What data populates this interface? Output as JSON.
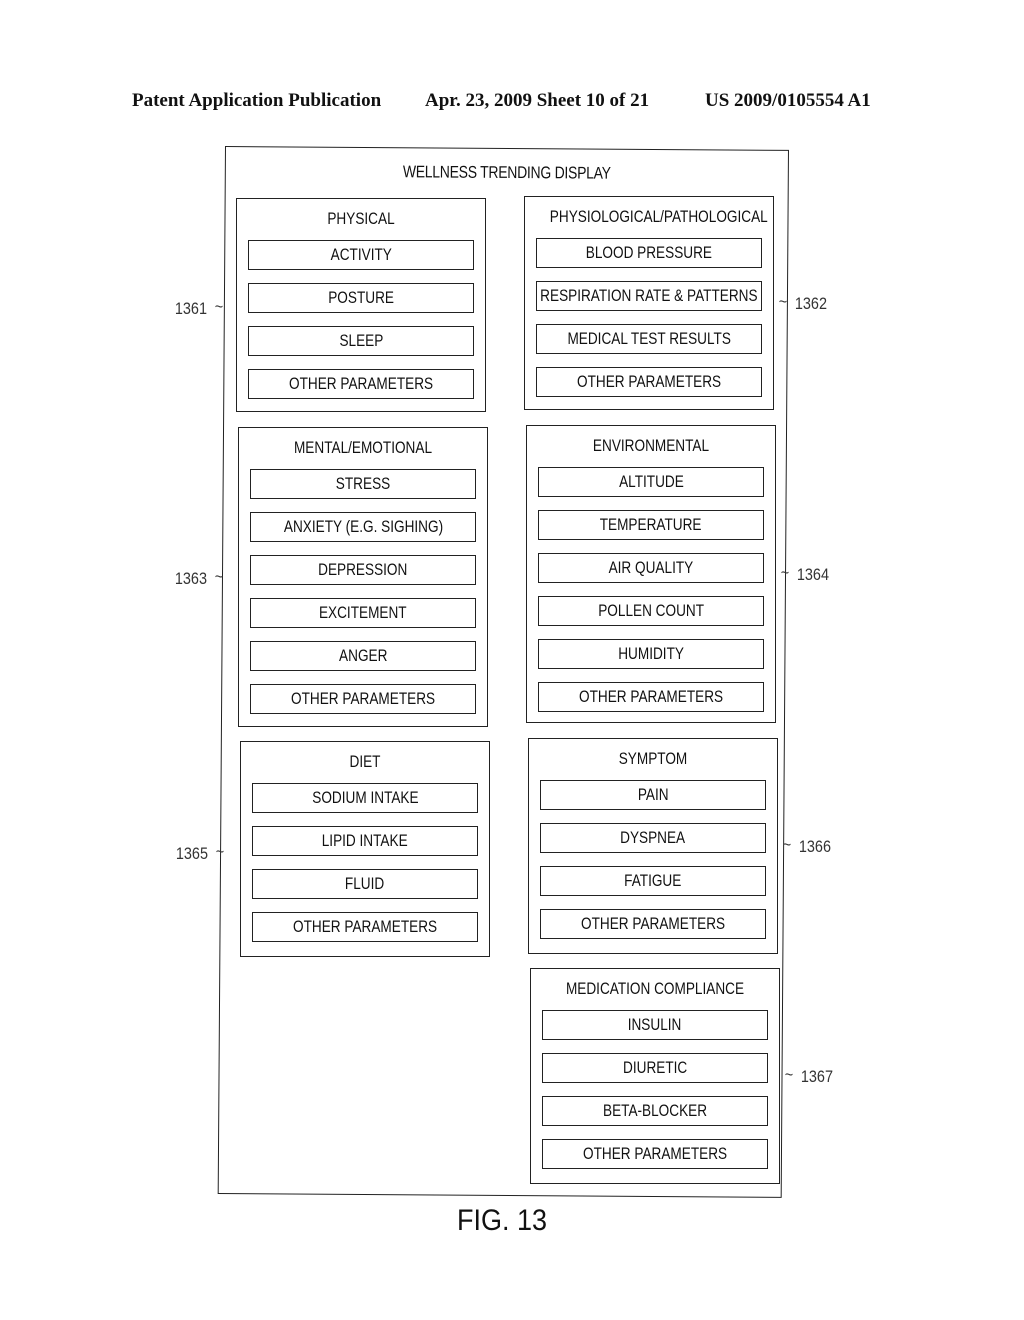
{
  "header": {
    "left": "Patent Application Publication",
    "middle": "Apr. 23, 2009  Sheet 10 of 21",
    "right": "US 2009/0105554 A1"
  },
  "diagram": {
    "title": "WELLNESS TRENDING DISPLAY",
    "groups": [
      {
        "ref": "1361",
        "title": "PHYSICAL",
        "items": [
          "ACTIVITY",
          "POSTURE",
          "SLEEP",
          "OTHER PARAMETERS"
        ]
      },
      {
        "ref": "1362",
        "title": "PHYSIOLOGICAL/PATHOLOGICAL",
        "items": [
          "BLOOD PRESSURE",
          "RESPIRATION RATE & PATTERNS",
          "MEDICAL TEST RESULTS",
          "OTHER PARAMETERS"
        ]
      },
      {
        "ref": "1363",
        "title": "MENTAL/EMOTIONAL",
        "items": [
          "STRESS",
          "ANXIETY (E.G. SIGHING)",
          "DEPRESSION",
          "EXCITEMENT",
          "ANGER",
          "OTHER PARAMETERS"
        ]
      },
      {
        "ref": "1364",
        "title": "ENVIRONMENTAL",
        "items": [
          "ALTITUDE",
          "TEMPERATURE",
          "AIR QUALITY",
          "POLLEN COUNT",
          "HUMIDITY",
          "OTHER PARAMETERS"
        ]
      },
      {
        "ref": "1365",
        "title": "DIET",
        "items": [
          "SODIUM INTAKE",
          "LIPID INTAKE",
          "FLUID",
          "OTHER PARAMETERS"
        ]
      },
      {
        "ref": "1366",
        "title": "SYMPTOM",
        "items": [
          "PAIN",
          "DYSPNEA",
          "FATIGUE",
          "OTHER PARAMETERS"
        ]
      },
      {
        "ref": "1367",
        "title": "MEDICATION COMPLIANCE",
        "items": [
          "INSULIN",
          "DIURETIC",
          "BETA-BLOCKER",
          "OTHER PARAMETERS"
        ]
      }
    ]
  },
  "figure_label": "FIG. 13"
}
